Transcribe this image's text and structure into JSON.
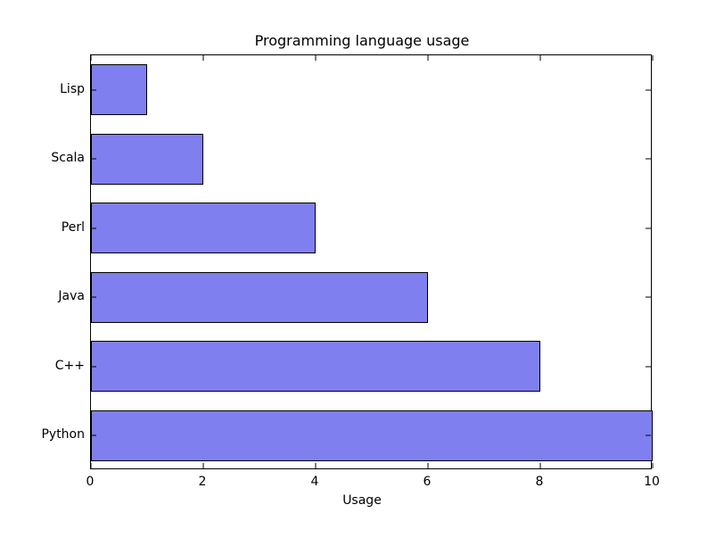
{
  "chart_data": {
    "type": "bar",
    "orientation": "horizontal",
    "title": "Programming language usage",
    "xlabel": "Usage",
    "ylabel": "",
    "categories": [
      "Python",
      "C++",
      "Java",
      "Perl",
      "Scala",
      "Lisp"
    ],
    "values": [
      10,
      8,
      6,
      4,
      2,
      1
    ],
    "xlim": [
      0,
      10
    ],
    "xticks": [
      0,
      2,
      4,
      6,
      8,
      10
    ],
    "bar_color": "#7f7ff0"
  }
}
